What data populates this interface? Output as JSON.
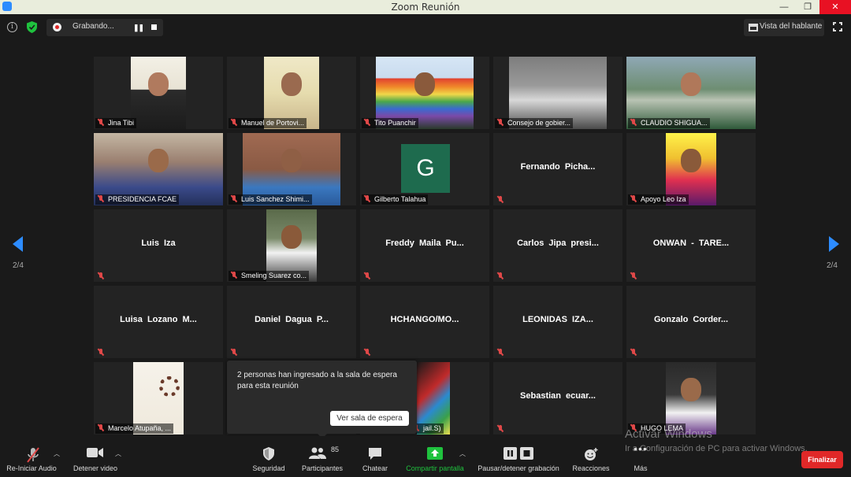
{
  "window": {
    "title": "Zoom Reunión",
    "minimize": "—",
    "restore": "❐",
    "close": "✕"
  },
  "topbar": {
    "recording_label": "Grabando...",
    "speaker_view_label": "Vista del hablante"
  },
  "grid": {
    "page_indicator": "2/4",
    "tiles": [
      {
        "name": "Jina Tibi",
        "video": true,
        "name_only": false
      },
      {
        "name": "Manuel de Portovi...",
        "video": true,
        "name_only": false
      },
      {
        "name": "Tito Puanchir",
        "video": true,
        "name_only": false
      },
      {
        "name": "Consejo de gobier...",
        "video": true,
        "name_only": false
      },
      {
        "name": "CLAUDIO SHIGUA...",
        "video": true,
        "name_only": false
      },
      {
        "name": "PRESIDENCIA FCAE",
        "video": true,
        "name_only": false
      },
      {
        "name": "Luis Sanchez Shimi...",
        "video": true,
        "name_only": false
      },
      {
        "name": "Gilberto Talahua",
        "video": false,
        "name_only": false,
        "avatar_letter": "G"
      },
      {
        "name": "Fernando Picha...",
        "video": false,
        "name_only": true
      },
      {
        "name": "Apoyo Leo Iza",
        "video": true,
        "name_only": false
      },
      {
        "name": "Luis Iza",
        "video": false,
        "name_only": true
      },
      {
        "name": "Smeling Suarez co...",
        "video": true,
        "name_only": false
      },
      {
        "name": "Freddy Maila Pu...",
        "video": false,
        "name_only": true
      },
      {
        "name": "Carlos Jipa presi...",
        "video": false,
        "name_only": true
      },
      {
        "name": "ONWAN - TARE...",
        "video": false,
        "name_only": true
      },
      {
        "name": "Luisa Lozano M...",
        "video": false,
        "name_only": true
      },
      {
        "name": "Daniel Dagua P...",
        "video": false,
        "name_only": true
      },
      {
        "name": "HCHANGO/MO...",
        "video": false,
        "name_only": true
      },
      {
        "name": "LEONIDAS IZA...",
        "video": false,
        "name_only": true
      },
      {
        "name": "Gonzalo Corder...",
        "video": false,
        "name_only": true
      },
      {
        "name": "Marcelo Atupaña, ...",
        "video": true,
        "name_only": false
      },
      {
        "name": "",
        "video": false,
        "name_only": false
      },
      {
        "name": "jail.S)",
        "video": true,
        "name_only": false
      },
      {
        "name": "Sebastian  ecuar...",
        "video": false,
        "name_only": true
      },
      {
        "name": "HUGO LEMA",
        "video": true,
        "name_only": false
      }
    ]
  },
  "popup": {
    "message": "2 personas han ingresado a la sala de espera para esta reunión",
    "button": "Ver sala de espera"
  },
  "toolbar": {
    "audio": "Re-Iniciar Audio",
    "video": "Detener video",
    "security": "Seguridad",
    "participants": "Participantes",
    "participants_count": "85",
    "chat": "Chatear",
    "share": "Compartir pantalla",
    "recording": "Pausar/detener grabación",
    "reactions": "Reacciones",
    "more": "Más",
    "end": "Finalizar"
  },
  "watermark": {
    "title": "Activar Windows",
    "subtitle": "Ir a Configuración de PC para activar Windows."
  },
  "colors": {
    "accent": "#2d8cff",
    "end": "#e02828",
    "share": "#1fc23e",
    "mic_muted": "#e04848"
  }
}
